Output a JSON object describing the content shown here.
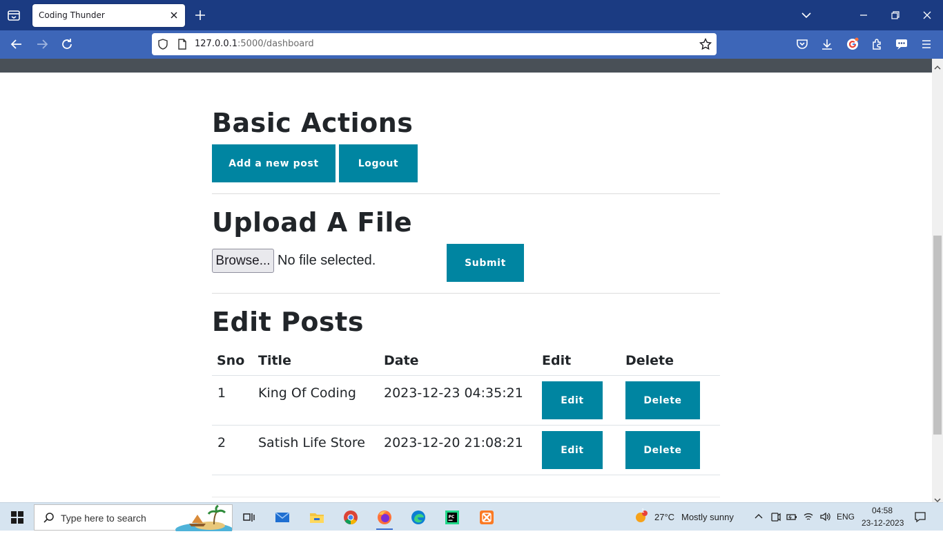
{
  "browser": {
    "tab_title": "Coding Thunder",
    "url_host": "127.0.0.1",
    "url_rest": ":5000/dashboard"
  },
  "basic_actions": {
    "heading": "Basic Actions",
    "add_post_label": "Add a new post",
    "logout_label": "Logout"
  },
  "upload": {
    "heading": "Upload A File",
    "browse_label": "Browse...",
    "file_status": "No file selected.",
    "submit_label": "Submit"
  },
  "edit_posts": {
    "heading": "Edit Posts",
    "columns": [
      "Sno",
      "Title",
      "Date",
      "Edit",
      "Delete"
    ],
    "rows": [
      {
        "sno": "1",
        "title": "King Of Coding",
        "date": "2023-12-23 04:35:21",
        "edit": "Edit",
        "delete": "Delete"
      },
      {
        "sno": "2",
        "title": "Satish Life Store",
        "date": "2023-12-20 21:08:21",
        "edit": "Edit",
        "delete": "Delete"
      }
    ]
  },
  "taskbar": {
    "search_placeholder": "Type here to search",
    "weather_temp": "27°C",
    "weather_desc": "Mostly sunny",
    "weather_badge": "1",
    "language": "ENG",
    "time": "04:58",
    "date": "23-12-2023"
  },
  "colors": {
    "primary_button": "#0085a1",
    "browser_tabbar": "#1b3b82",
    "browser_navbar": "#3d66b8"
  }
}
